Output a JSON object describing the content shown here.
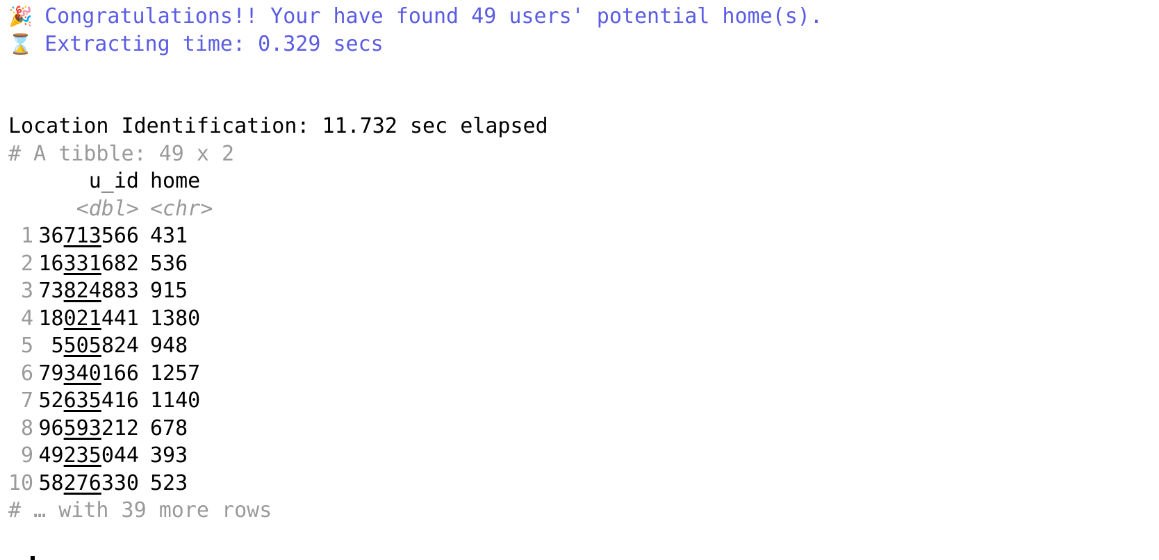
{
  "messages": {
    "congrats_icon": "🎉",
    "congrats_text": "Congratulations!! Your have found 49 users' potential home(s).",
    "time_icon": "⌛",
    "time_text": "Extracting time: 0.329 secs",
    "elapsed_text": "Location Identification: 11.732 sec elapsed"
  },
  "tibble": {
    "header": "# A tibble: 49 x 2",
    "columns": [
      {
        "name": "u_id",
        "type": "<dbl>"
      },
      {
        "name": "home",
        "type": "<chr>"
      }
    ],
    "rows": [
      {
        "n": "1",
        "u_id": "36713566",
        "home": "431"
      },
      {
        "n": "2",
        "u_id": "16331682",
        "home": "536"
      },
      {
        "n": "3",
        "u_id": "73824883",
        "home": "915"
      },
      {
        "n": "4",
        "u_id": "18021441",
        "home": "1380"
      },
      {
        "n": "5",
        "u_id": "5505824",
        "home": "948"
      },
      {
        "n": "6",
        "u_id": "79340166",
        "home": "1257"
      },
      {
        "n": "7",
        "u_id": "52635416",
        "home": "1140"
      },
      {
        "n": "8",
        "u_id": "96593212",
        "home": "678"
      },
      {
        "n": "9",
        "u_id": "49235044",
        "home": "393"
      },
      {
        "n": "10",
        "u_id": "58276330",
        "home": "523"
      }
    ],
    "footer": "# … with 39 more rows"
  },
  "colors": {
    "message": "#5a5ce3",
    "muted": "#9a9a9a",
    "text": "#000000"
  }
}
